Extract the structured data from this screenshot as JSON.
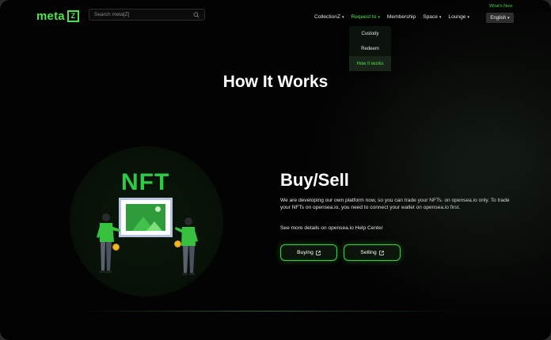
{
  "brand": {
    "logo_text": "meta",
    "logo_mark": "Z"
  },
  "search": {
    "placeholder": "Search meta[Z]"
  },
  "header": {
    "whats_new": "What's New",
    "language": "English"
  },
  "nav": {
    "items": [
      {
        "label": "CollectionZ",
        "has_caret": true
      },
      {
        "label": "Request to",
        "has_caret": true,
        "active": true
      },
      {
        "label": "Membership",
        "has_caret": false
      },
      {
        "label": "Space",
        "has_caret": true
      },
      {
        "label": "Lounge",
        "has_caret": true
      }
    ]
  },
  "dropdown": {
    "items": [
      {
        "label": "Custody"
      },
      {
        "label": "Redeem"
      },
      {
        "label": "How it works",
        "active": true
      }
    ]
  },
  "page": {
    "title": "How It Works"
  },
  "illustration": {
    "nft_text": "NFT"
  },
  "section": {
    "heading": "Buy/Sell",
    "description": "We are developing our own platform now, so you can trade your NFTs. on opensea.io only. To trade your NFTs on opensea.io, you need to connect your wallet on opensea.io first.",
    "more": "See more details on opensea.io Help Center",
    "buttons": {
      "buying": "Buying",
      "selling": "Selling"
    }
  },
  "colors": {
    "accent": "#4fe34a",
    "background": "#020202"
  }
}
